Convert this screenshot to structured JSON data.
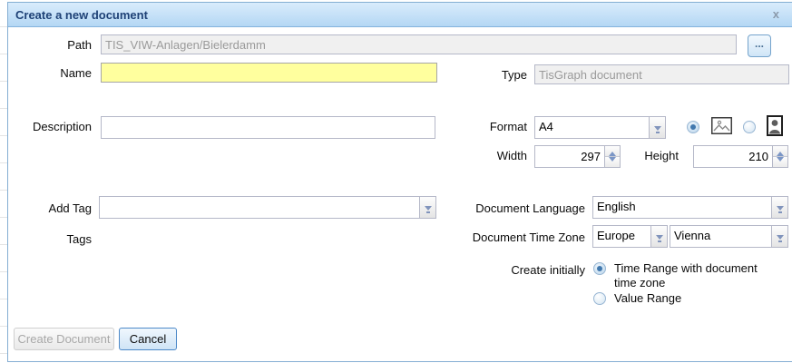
{
  "dialog": {
    "title": "Create a new document",
    "close_glyph": "x"
  },
  "path": {
    "label": "Path",
    "value": "TIS_VIW-Anlagen/Bielerdamm",
    "browse_label": "..."
  },
  "name": {
    "label": "Name",
    "value": ""
  },
  "type": {
    "label": "Type",
    "value": "TisGraph document"
  },
  "description": {
    "label": "Description",
    "value": ""
  },
  "format": {
    "label": "Format",
    "value": "A4"
  },
  "orientation": {
    "selected": "landscape",
    "landscape_icon": "landscape-image",
    "portrait_icon": "portrait-person"
  },
  "width": {
    "label": "Width",
    "value": "297"
  },
  "height": {
    "label": "Height",
    "value": "210"
  },
  "add_tag": {
    "label": "Add Tag",
    "value": ""
  },
  "tags": {
    "label": "Tags"
  },
  "document_language": {
    "label": "Document Language",
    "value": "English"
  },
  "document_time_zone": {
    "label": "Document Time Zone",
    "region": "Europe",
    "city": "Vienna"
  },
  "create_initially": {
    "label": "Create initially",
    "options": [
      {
        "label": "Time Range with document time zone",
        "selected": true
      },
      {
        "label": "Value Range",
        "selected": false
      }
    ]
  },
  "footer": {
    "create_label": "Create Document",
    "cancel_label": "Cancel"
  },
  "colors": {
    "titlebar_top": "#d9ecfc",
    "titlebar_bottom": "#b4d7f4",
    "dialog_border": "#84aed3",
    "required_yellow": "#ffff9e",
    "disabled_bg": "#f0f0f0",
    "disabled_text": "#9a9a9a",
    "radio_dot": "#4178ae",
    "primary_button_border": "#4d89c8"
  }
}
